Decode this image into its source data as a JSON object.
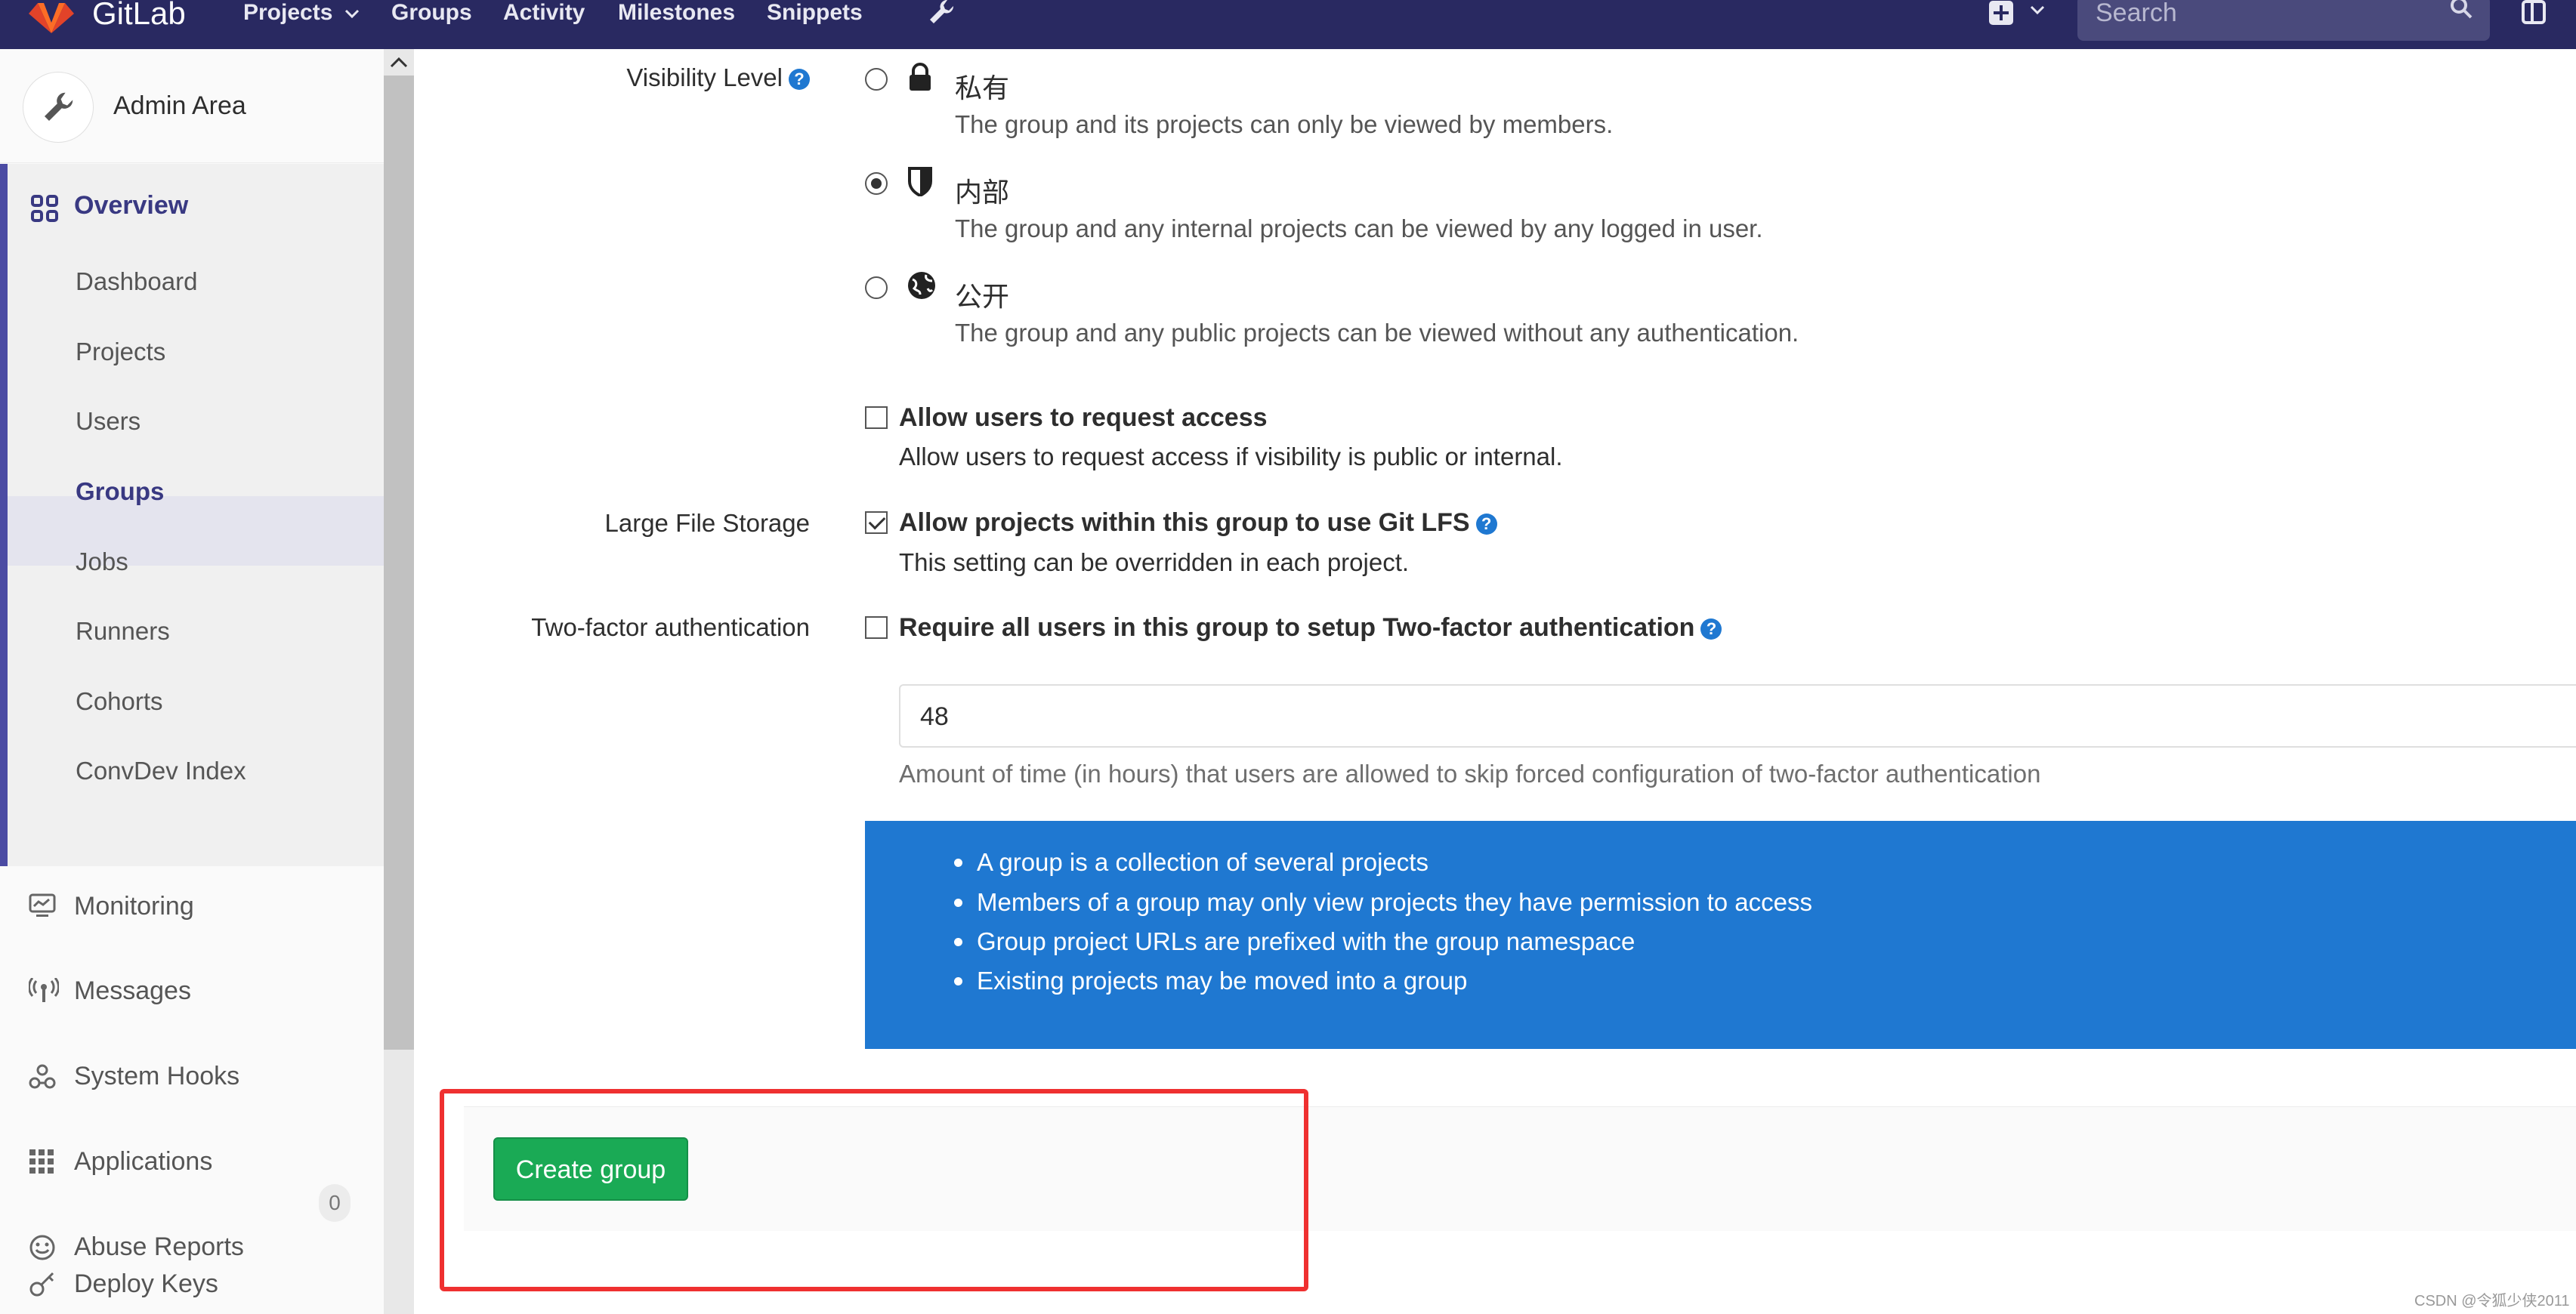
{
  "navbar": {
    "brand": "GitLab",
    "links": [
      {
        "label": "Projects",
        "has_caret": true
      },
      {
        "label": "Groups"
      },
      {
        "label": "Activity"
      },
      {
        "label": "Milestones"
      },
      {
        "label": "Snippets"
      }
    ],
    "search_placeholder": "Search",
    "icons": [
      "gitlab-logo-icon",
      "wrench-icon",
      "plus-square-icon",
      "chevron-down-icon",
      "search-icon",
      "sidebar-toggle-icon"
    ],
    "colors": {
      "navbar_bg": "#292961"
    }
  },
  "sidebar": {
    "title": "Admin Area",
    "overview_label": "Overview",
    "overview_items": [
      {
        "label": "Dashboard",
        "active": false
      },
      {
        "label": "Projects",
        "active": false
      },
      {
        "label": "Users",
        "active": false
      },
      {
        "label": "Groups",
        "active": true
      },
      {
        "label": "Jobs",
        "active": false
      },
      {
        "label": "Runners",
        "active": false
      },
      {
        "label": "Cohorts",
        "active": false
      },
      {
        "label": "ConvDev Index",
        "active": false
      }
    ],
    "items": [
      {
        "label": "Monitoring",
        "icon": "monitor-icon"
      },
      {
        "label": "Messages",
        "icon": "broadcast-icon"
      },
      {
        "label": "System Hooks",
        "icon": "hook-icon"
      },
      {
        "label": "Applications",
        "icon": "apps-grid-icon"
      },
      {
        "label": "Abuse Reports",
        "icon": "smiley-icon",
        "badge": "0"
      },
      {
        "label": "Deploy Keys",
        "icon": "key-icon"
      }
    ],
    "colors": {
      "active_accent": "#393982"
    }
  },
  "form": {
    "visibility": {
      "label": "Visibility Level",
      "selected": "internal",
      "options": [
        {
          "name": "私有",
          "desc": "The group and its projects can only be viewed by members.",
          "icon": "lock-icon",
          "checked": false
        },
        {
          "name": "内部",
          "desc": "The group and any internal projects can be viewed by any logged in user.",
          "icon": "shield-icon",
          "checked": true
        },
        {
          "name": "公开",
          "desc": "The group and any public projects can be viewed without any authentication.",
          "icon": "globe-icon",
          "checked": false
        }
      ]
    },
    "request_access": {
      "title": "Allow users to request access",
      "desc": "Allow users to request access if visibility is public or internal.",
      "checked": false
    },
    "lfs": {
      "label": "Large File Storage",
      "title": "Allow projects within this group to use Git LFS",
      "desc": "This setting can be overridden in each project.",
      "checked": true
    },
    "two_factor": {
      "label": "Two-factor authentication",
      "title": "Require all users in this group to setup Two-factor authentication",
      "checked": false,
      "grace_period_value": "48",
      "grace_period_help": "Amount of time (in hours) that users are allowed to skip forced configuration of two-factor authentication"
    },
    "info": [
      "A group is a collection of several projects",
      "Members of a group may only view projects they have permission to access",
      "Group project URLs are prefixed with the group namespace",
      "Existing projects may be moved into a group"
    ],
    "submit_label": "Create group",
    "colors": {
      "info_bg": "#1f78d1",
      "submit_bg": "#1aaa55",
      "highlight": "#ef3030"
    }
  },
  "watermark": "CSDN @令狐少侠2011"
}
